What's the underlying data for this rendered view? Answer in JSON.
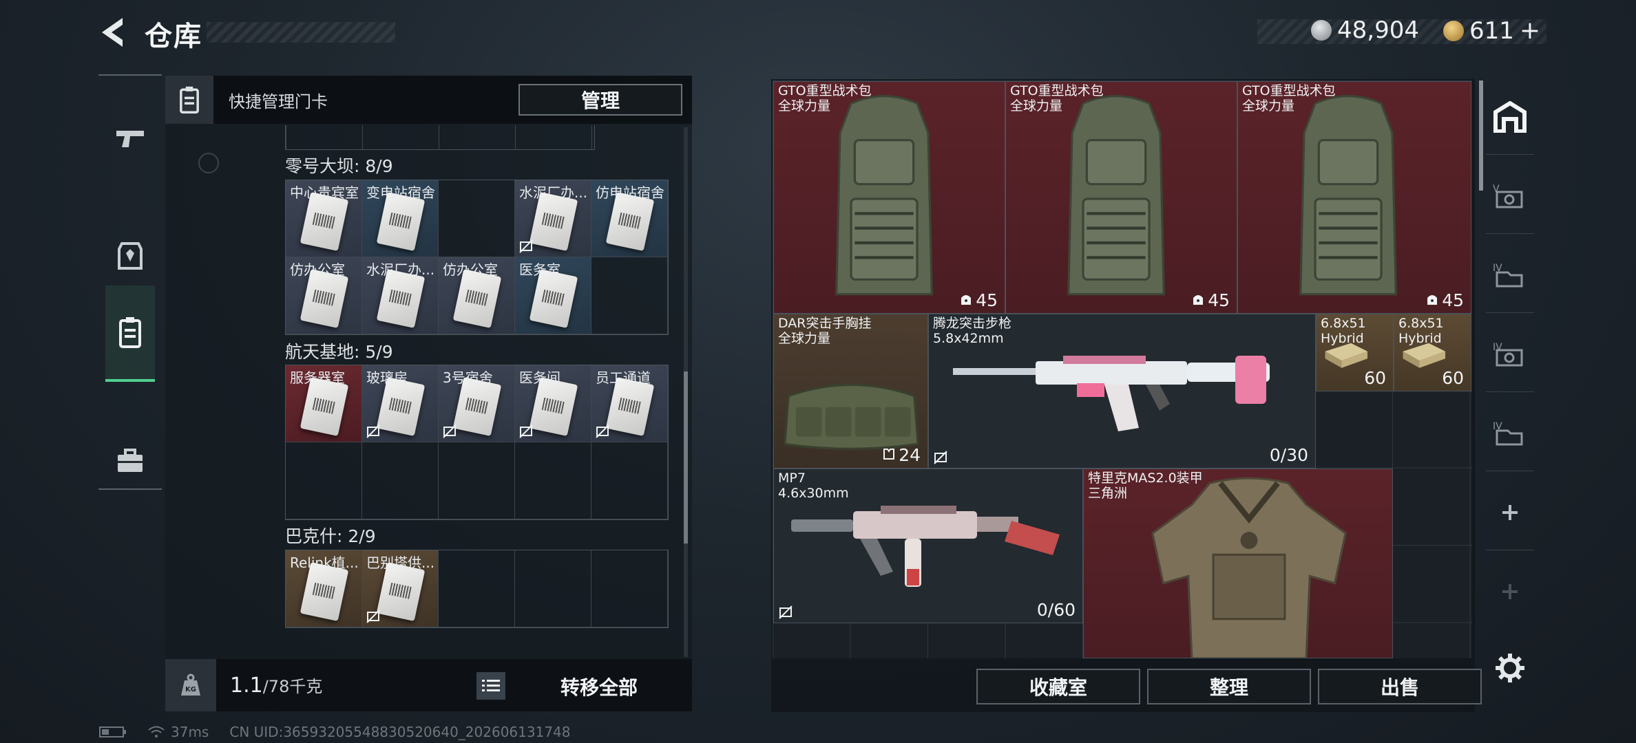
{
  "header": {
    "title": "仓库"
  },
  "currency": {
    "primary": "48,904",
    "secondary": "611",
    "secondary_plus": "+"
  },
  "quick_manage": {
    "label": "快捷管理门卡",
    "button": "管理"
  },
  "sections": [
    {
      "title": "零号大坝: 8/9",
      "cells": [
        {
          "label": "中心贵宾室",
          "style": "card"
        },
        {
          "label": "变电站宿舍",
          "style": "card blue"
        },
        {
          "label": "",
          "style": "empty"
        },
        {
          "label": "水泥厂办...",
          "style": "card",
          "nolink": true
        },
        {
          "label": "仿电站宿舍",
          "style": "card blue"
        },
        {
          "label": "仿办公室",
          "style": "card"
        },
        {
          "label": "水泥厂办...",
          "style": "card"
        },
        {
          "label": "仿办公室",
          "style": "card"
        },
        {
          "label": "医务室",
          "style": "card blue"
        }
      ]
    },
    {
      "title": "航天基地: 5/9",
      "cells": [
        {
          "label": "服务器室",
          "style": "card red"
        },
        {
          "label": "玻璃房",
          "style": "card",
          "nolink": true
        },
        {
          "label": "3号宿舍",
          "style": "card",
          "nolink": true
        },
        {
          "label": "医务间",
          "style": "card",
          "nolink": true
        },
        {
          "label": "员工通道",
          "style": "card",
          "nolink": true
        }
      ]
    },
    {
      "title": "巴克什: 2/9",
      "cells": [
        {
          "label": "Relink植...",
          "style": "card gold"
        },
        {
          "label": "巴别塔供...",
          "style": "card gold",
          "nolink": true
        }
      ]
    }
  ],
  "weight": {
    "value": "1.1",
    "unit": "/78千克",
    "icon_text": "KG"
  },
  "transfer_all": "转移全部",
  "stash_items": [
    {
      "name": "GTO重型战术包",
      "sub": "全球力量",
      "count": "45",
      "color": "red"
    },
    {
      "name": "GTO重型战术包",
      "sub": "全球力量",
      "count": "45",
      "color": "red"
    },
    {
      "name": "GTO重型战术包",
      "sub": "全球力量",
      "count": "45",
      "color": "red"
    },
    {
      "name": "DAR突击手胸挂",
      "sub": "全球力量",
      "count": "24",
      "color": "brown"
    },
    {
      "name": "腾龙突击步枪",
      "sub": "5.8x42mm",
      "count": "0/30",
      "color": "dark"
    },
    {
      "name": "6.8x51",
      "sub": "Hybrid",
      "count": "60",
      "color": "tan"
    },
    {
      "name": "6.8x51",
      "sub": "Hybrid",
      "count": "60",
      "color": "tan"
    },
    {
      "name": "MP7",
      "sub": "4.6x30mm",
      "count": "0/60",
      "color": "dark"
    },
    {
      "name": "特里克MAS2.0装甲",
      "sub": "三角洲",
      "count": "",
      "color": "red"
    }
  ],
  "bottom_buttons": {
    "vault": "收藏室",
    "sort": "整理",
    "sell": "出售"
  },
  "side_tabs": [
    "home-icon",
    "v-tier-icon",
    "iv-tier-icon",
    "iv-tier-icon",
    "iv-tier-icon",
    "add-icon",
    "add-icon"
  ],
  "status": {
    "ping": "37ms",
    "uid": "CN UID:3659320554883052064​0_202606131748"
  },
  "colors": {
    "accent": "#4fd08f",
    "rare_red": "#5a2329",
    "gold": "#5b4a36"
  }
}
